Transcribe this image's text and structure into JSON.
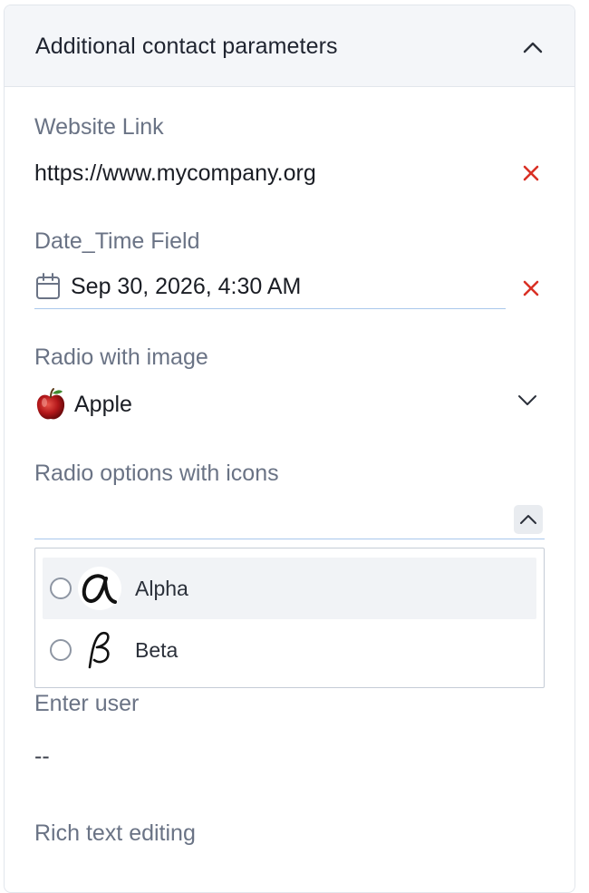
{
  "panel": {
    "title": "Additional contact parameters"
  },
  "fields": {
    "website": {
      "label": "Website Link",
      "value": "https://www.mycompany.org"
    },
    "datetime": {
      "label": "Date_Time Field",
      "value": "Sep 30, 2026, 4:30 AM"
    },
    "radio_image": {
      "label": "Radio with image",
      "value": "Apple"
    },
    "radio_icons": {
      "label": "Radio options with icons",
      "value": "",
      "options": [
        {
          "label": "Alpha",
          "icon": "alpha-icon",
          "checked": false
        },
        {
          "label": "Beta",
          "icon": "beta-icon",
          "checked": false
        }
      ]
    },
    "user": {
      "label": "Enter user",
      "value": "--"
    },
    "rich_text": {
      "label": "Rich text editing"
    }
  },
  "colors": {
    "clear_icon": "#d93025",
    "underline": "#a9c7ec",
    "label": "#6a7385",
    "header_bg": "#f4f6f9"
  }
}
